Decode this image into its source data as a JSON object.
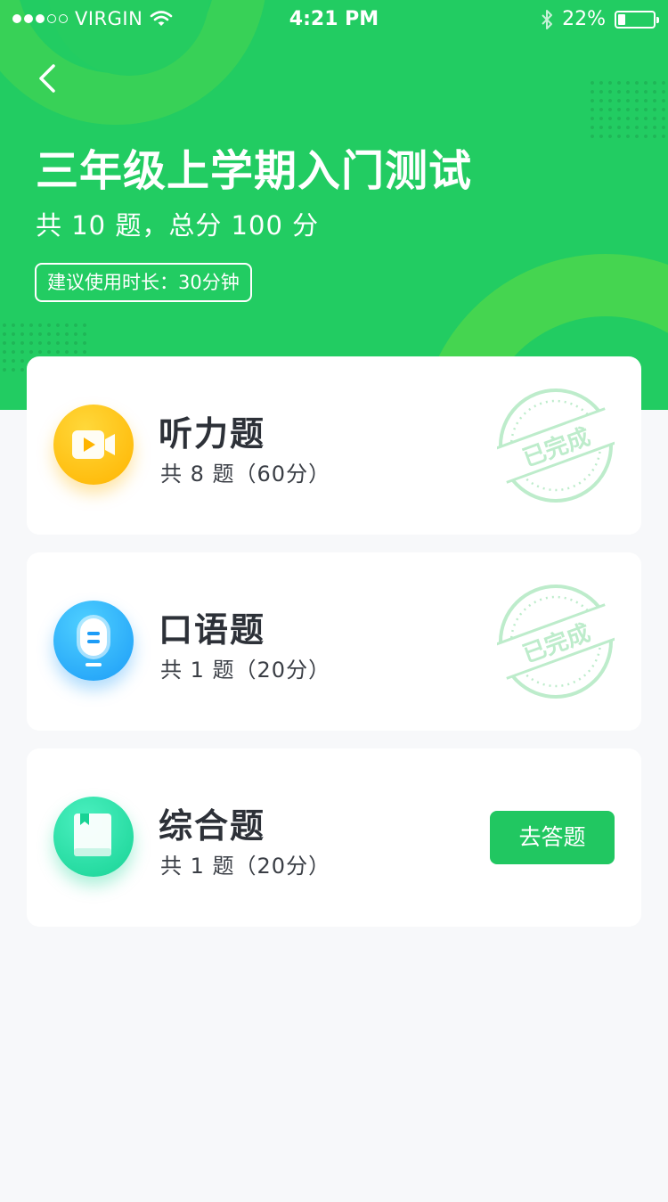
{
  "statusbar": {
    "carrier": "VIRGIN",
    "time": "4:21 PM",
    "battery_text": "22%",
    "battery_level": 0.22
  },
  "header": {
    "title": "三年级上学期入门测试",
    "subtitle": "共 10 题，总分 100 分",
    "duration_tag": "建议使用时长：30分钟"
  },
  "sections": [
    {
      "title": "听力题",
      "meta": "共 8 题（60分）",
      "status": "已完成",
      "icon": "video-icon",
      "color": "#ffb400"
    },
    {
      "title": "口语题",
      "meta": "共 1 题（20分）",
      "status": "已完成",
      "icon": "microphone-icon",
      "color": "#1c9cf7"
    },
    {
      "title": "综合题",
      "meta": "共 1 题（20分）",
      "action": "去答题",
      "icon": "book-icon",
      "color": "#18d395"
    }
  ],
  "colors": {
    "primary": "#22cc62",
    "stamp": "#bdeccb",
    "title_text": "#2d3138"
  }
}
